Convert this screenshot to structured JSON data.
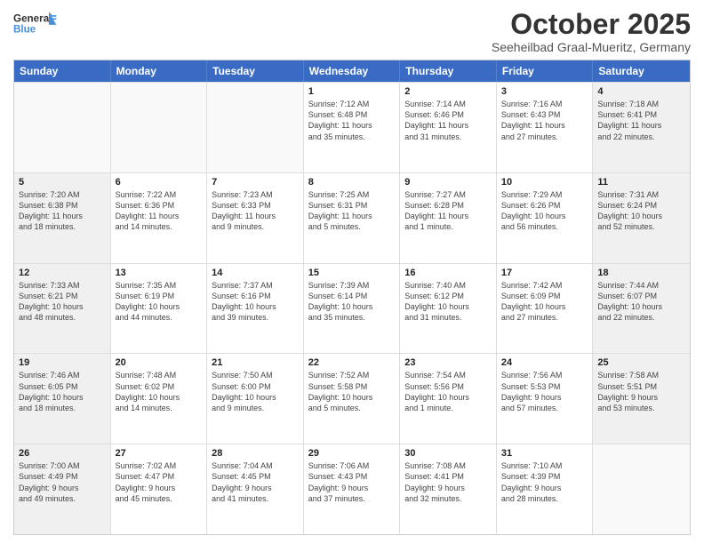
{
  "header": {
    "logo_general": "General",
    "logo_blue": "Blue",
    "month": "October 2025",
    "location": "Seeheilbad Graal-Mueritz, Germany"
  },
  "days_of_week": [
    "Sunday",
    "Monday",
    "Tuesday",
    "Wednesday",
    "Thursday",
    "Friday",
    "Saturday"
  ],
  "weeks": [
    [
      {
        "day": "",
        "info": "",
        "empty": true
      },
      {
        "day": "",
        "info": "",
        "empty": true
      },
      {
        "day": "",
        "info": "",
        "empty": true
      },
      {
        "day": "1",
        "info": "Sunrise: 7:12 AM\nSunset: 6:48 PM\nDaylight: 11 hours\nand 35 minutes.",
        "empty": false
      },
      {
        "day": "2",
        "info": "Sunrise: 7:14 AM\nSunset: 6:46 PM\nDaylight: 11 hours\nand 31 minutes.",
        "empty": false
      },
      {
        "day": "3",
        "info": "Sunrise: 7:16 AM\nSunset: 6:43 PM\nDaylight: 11 hours\nand 27 minutes.",
        "empty": false
      },
      {
        "day": "4",
        "info": "Sunrise: 7:18 AM\nSunset: 6:41 PM\nDaylight: 11 hours\nand 22 minutes.",
        "empty": false,
        "shaded": true
      }
    ],
    [
      {
        "day": "5",
        "info": "Sunrise: 7:20 AM\nSunset: 6:38 PM\nDaylight: 11 hours\nand 18 minutes.",
        "empty": false,
        "shaded": true
      },
      {
        "day": "6",
        "info": "Sunrise: 7:22 AM\nSunset: 6:36 PM\nDaylight: 11 hours\nand 14 minutes.",
        "empty": false
      },
      {
        "day": "7",
        "info": "Sunrise: 7:23 AM\nSunset: 6:33 PM\nDaylight: 11 hours\nand 9 minutes.",
        "empty": false
      },
      {
        "day": "8",
        "info": "Sunrise: 7:25 AM\nSunset: 6:31 PM\nDaylight: 11 hours\nand 5 minutes.",
        "empty": false
      },
      {
        "day": "9",
        "info": "Sunrise: 7:27 AM\nSunset: 6:28 PM\nDaylight: 11 hours\nand 1 minute.",
        "empty": false
      },
      {
        "day": "10",
        "info": "Sunrise: 7:29 AM\nSunset: 6:26 PM\nDaylight: 10 hours\nand 56 minutes.",
        "empty": false
      },
      {
        "day": "11",
        "info": "Sunrise: 7:31 AM\nSunset: 6:24 PM\nDaylight: 10 hours\nand 52 minutes.",
        "empty": false,
        "shaded": true
      }
    ],
    [
      {
        "day": "12",
        "info": "Sunrise: 7:33 AM\nSunset: 6:21 PM\nDaylight: 10 hours\nand 48 minutes.",
        "empty": false,
        "shaded": true
      },
      {
        "day": "13",
        "info": "Sunrise: 7:35 AM\nSunset: 6:19 PM\nDaylight: 10 hours\nand 44 minutes.",
        "empty": false
      },
      {
        "day": "14",
        "info": "Sunrise: 7:37 AM\nSunset: 6:16 PM\nDaylight: 10 hours\nand 39 minutes.",
        "empty": false
      },
      {
        "day": "15",
        "info": "Sunrise: 7:39 AM\nSunset: 6:14 PM\nDaylight: 10 hours\nand 35 minutes.",
        "empty": false
      },
      {
        "day": "16",
        "info": "Sunrise: 7:40 AM\nSunset: 6:12 PM\nDaylight: 10 hours\nand 31 minutes.",
        "empty": false
      },
      {
        "day": "17",
        "info": "Sunrise: 7:42 AM\nSunset: 6:09 PM\nDaylight: 10 hours\nand 27 minutes.",
        "empty": false
      },
      {
        "day": "18",
        "info": "Sunrise: 7:44 AM\nSunset: 6:07 PM\nDaylight: 10 hours\nand 22 minutes.",
        "empty": false,
        "shaded": true
      }
    ],
    [
      {
        "day": "19",
        "info": "Sunrise: 7:46 AM\nSunset: 6:05 PM\nDaylight: 10 hours\nand 18 minutes.",
        "empty": false,
        "shaded": true
      },
      {
        "day": "20",
        "info": "Sunrise: 7:48 AM\nSunset: 6:02 PM\nDaylight: 10 hours\nand 14 minutes.",
        "empty": false
      },
      {
        "day": "21",
        "info": "Sunrise: 7:50 AM\nSunset: 6:00 PM\nDaylight: 10 hours\nand 9 minutes.",
        "empty": false
      },
      {
        "day": "22",
        "info": "Sunrise: 7:52 AM\nSunset: 5:58 PM\nDaylight: 10 hours\nand 5 minutes.",
        "empty": false
      },
      {
        "day": "23",
        "info": "Sunrise: 7:54 AM\nSunset: 5:56 PM\nDaylight: 10 hours\nand 1 minute.",
        "empty": false
      },
      {
        "day": "24",
        "info": "Sunrise: 7:56 AM\nSunset: 5:53 PM\nDaylight: 9 hours\nand 57 minutes.",
        "empty": false
      },
      {
        "day": "25",
        "info": "Sunrise: 7:58 AM\nSunset: 5:51 PM\nDaylight: 9 hours\nand 53 minutes.",
        "empty": false,
        "shaded": true
      }
    ],
    [
      {
        "day": "26",
        "info": "Sunrise: 7:00 AM\nSunset: 4:49 PM\nDaylight: 9 hours\nand 49 minutes.",
        "empty": false,
        "shaded": true
      },
      {
        "day": "27",
        "info": "Sunrise: 7:02 AM\nSunset: 4:47 PM\nDaylight: 9 hours\nand 45 minutes.",
        "empty": false
      },
      {
        "day": "28",
        "info": "Sunrise: 7:04 AM\nSunset: 4:45 PM\nDaylight: 9 hours\nand 41 minutes.",
        "empty": false
      },
      {
        "day": "29",
        "info": "Sunrise: 7:06 AM\nSunset: 4:43 PM\nDaylight: 9 hours\nand 37 minutes.",
        "empty": false
      },
      {
        "day": "30",
        "info": "Sunrise: 7:08 AM\nSunset: 4:41 PM\nDaylight: 9 hours\nand 32 minutes.",
        "empty": false
      },
      {
        "day": "31",
        "info": "Sunrise: 7:10 AM\nSunset: 4:39 PM\nDaylight: 9 hours\nand 28 minutes.",
        "empty": false
      },
      {
        "day": "",
        "info": "",
        "empty": true,
        "shaded": true
      }
    ]
  ]
}
